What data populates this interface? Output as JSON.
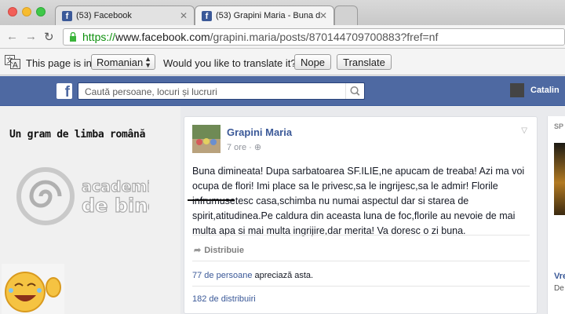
{
  "browser": {
    "tabs": [
      {
        "title": "(53) Facebook"
      },
      {
        "title": "(53) Grapini Maria - Buna d"
      }
    ],
    "url": {
      "scheme": "https://",
      "host": "www.facebook.com",
      "path": "/grapini.maria/posts/870144709700883?fref=nf"
    },
    "translate_bar": {
      "prefix": "This page is in",
      "language": "Romanian",
      "question": "Would you like to translate it?",
      "nope": "Nope",
      "translate": "Translate"
    }
  },
  "facebook": {
    "search_placeholder": "Caută persoane, locuri și lucruri",
    "user_name": "Catalin"
  },
  "left": {
    "page_name": "Un gram de limba română",
    "logo_line1": "academia",
    "logo_line2": "de bine"
  },
  "post": {
    "author": "Grapini Maria",
    "time": "7 ore",
    "body": "Buna dimineata! Dupa sarbatoarea SF.ILIE,ne apucam de treaba! Azi ma voi ocupa de flori! Imi place sa le privesc,sa le ingrijesc,sa le admir! Florile infrumusetesc casa,schimba nu numai aspectul dar si starea de spirit,atitudinea.Pe caldura din aceasta luna de foc,florile au nevoie de mai multa apa si mai multa ingrijire,dar merita! Va doresc o zi buna.",
    "share_label": "Distribuie",
    "likes_count": "77 de persoane",
    "likes_suffix": " apreciază asta.",
    "shares_text": "182 de distribuiri"
  },
  "right": {
    "section": "SP",
    "title": "Vre",
    "sub": "De"
  },
  "colors": {
    "fb_blue": "#4e69a2",
    "link": "#3b5998",
    "https_green": "#0c8f0c"
  }
}
